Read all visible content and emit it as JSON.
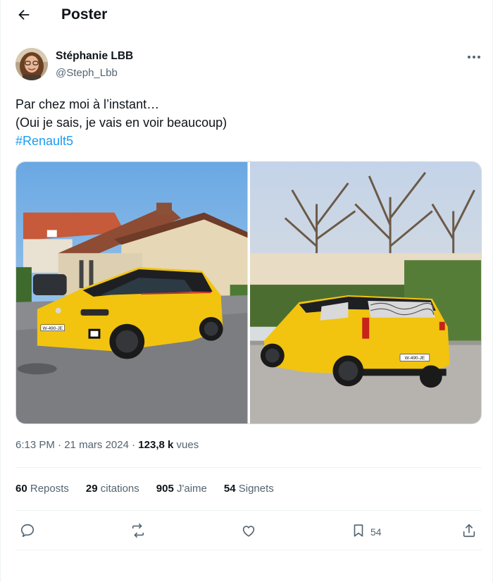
{
  "header": {
    "title": "Poster",
    "back_icon": "arrow-left-icon"
  },
  "author": {
    "name": "Stéphanie LBB",
    "handle": "@Steph_Lbb",
    "more_icon": "more-horizontal-icon"
  },
  "post": {
    "lines": [
      "Par chez moi à l’instant…",
      "(Oui je sais, je vais en voir beaucoup)"
    ],
    "hashtag": "#Renault5",
    "plate_text": "W-490-JE"
  },
  "meta": {
    "time": "6:13 PM",
    "date": "21 mars 2024",
    "separator": "·",
    "views_count": "123,8 k",
    "views_label": "vues"
  },
  "stats": {
    "reposts_count": "60",
    "reposts_label": "Reposts",
    "quotes_count": "29",
    "quotes_label": "citations",
    "likes_count": "905",
    "likes_label": "J'aime",
    "bookmarks_count": "54",
    "bookmarks_label": "Signets"
  },
  "actions": {
    "reply_icon": "reply-icon",
    "repost_icon": "repost-icon",
    "like_icon": "heart-icon",
    "bookmark_icon": "bookmark-icon",
    "bookmark_count": "54",
    "share_icon": "share-icon"
  },
  "colors": {
    "text_primary": "#0f1419",
    "text_secondary": "#536471",
    "link": "#1d9bf0",
    "border": "#eff3f4",
    "car_yellow": "#f2c40f"
  }
}
